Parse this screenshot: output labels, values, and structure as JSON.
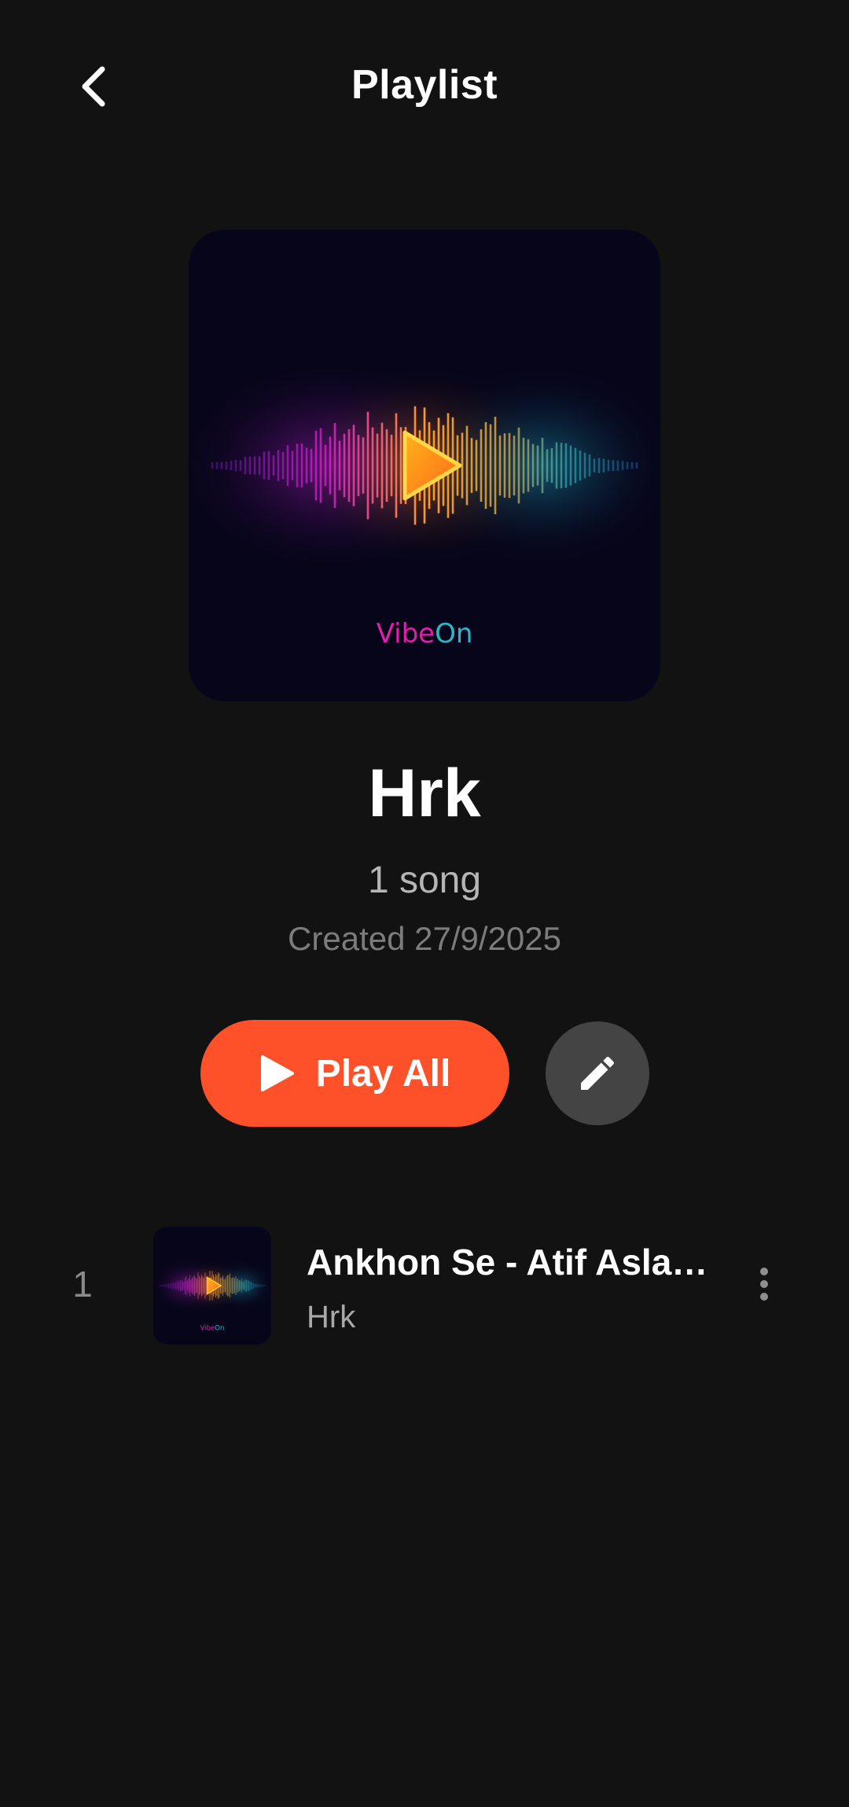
{
  "header": {
    "title": "Playlist",
    "back_icon": "chevron-left-icon"
  },
  "cover": {
    "brand_part1": "Vibe",
    "brand_part2": "On",
    "play_icon": "play-triangle-icon",
    "colors": {
      "magenta": "#e21fd0",
      "orange": "#ff9a1f",
      "cyan": "#2ab8c9",
      "background": "#07051a"
    }
  },
  "playlist": {
    "name": "Hrk",
    "song_count": "1 song",
    "created": "Created 27/9/2025"
  },
  "actions": {
    "play_all_label": "Play All",
    "play_icon": "play-icon",
    "edit_icon": "pencil-icon",
    "accent_color": "#ff5129"
  },
  "tracks": [
    {
      "index": "1",
      "title": "Ankhon Se - Atif Aslam…",
      "artist": "Hrk",
      "menu_icon": "more-vertical-icon"
    }
  ]
}
